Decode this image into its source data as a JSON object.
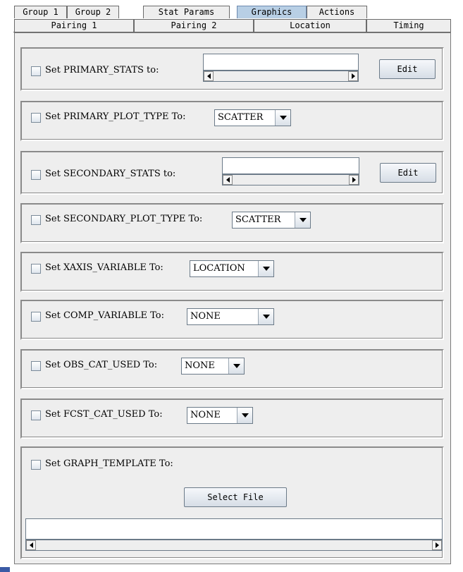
{
  "tabs": {
    "row1": [
      {
        "label": "Group 1"
      },
      {
        "label": "Group 2"
      },
      {
        "label": "Stat Params"
      },
      {
        "label": "Graphics"
      },
      {
        "label": "Actions"
      }
    ],
    "row2": [
      {
        "label": "Pairing 1"
      },
      {
        "label": "Pairing 2"
      },
      {
        "label": "Location"
      },
      {
        "label": "Timing"
      }
    ],
    "selected": "Graphics"
  },
  "rows": {
    "primary_stats": {
      "label": "Set PRIMARY_STATS to:",
      "value": "",
      "edit_label": "Edit"
    },
    "primary_plot_type": {
      "label": "Set PRIMARY_PLOT_TYPE To:",
      "value": "SCATTER"
    },
    "secondary_stats": {
      "label": "Set SECONDARY_STATS to:",
      "value": "",
      "edit_label": "Edit"
    },
    "secondary_plot_type": {
      "label": "Set SECONDARY_PLOT_TYPE To:",
      "value": "SCATTER"
    },
    "xaxis_variable": {
      "label": "Set XAXIS_VARIABLE To:",
      "value": "LOCATION"
    },
    "comp_variable": {
      "label": "Set COMP_VARIABLE To:",
      "value": "NONE"
    },
    "obs_cat_used": {
      "label": "Set OBS_CAT_USED To:",
      "value": "NONE"
    },
    "fcst_cat_used": {
      "label": "Set FCST_CAT_USED To:",
      "value": "NONE"
    },
    "graph_template": {
      "label": "Set GRAPH_TEMPLATE To:",
      "select_file_label": "Select File",
      "value": ""
    }
  },
  "colors": {
    "panel_bg": "#eeeeee",
    "selected_tab": "#b8cfe5"
  },
  "icons": {
    "dropdown": "chevron-down-icon",
    "scroll_left": "arrow-left-icon",
    "scroll_right": "arrow-right-icon"
  }
}
